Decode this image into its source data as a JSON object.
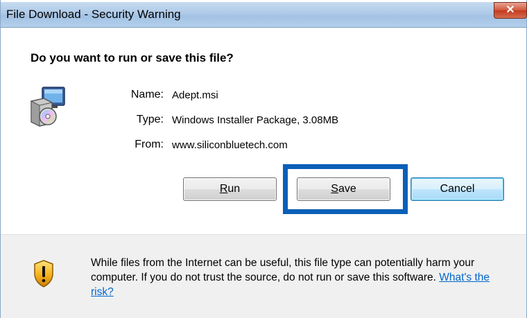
{
  "window": {
    "title": "File Download - Security Warning",
    "close_glyph": "✕"
  },
  "dialog": {
    "question": "Do you want to run or save this file?",
    "fields": {
      "name_label": "Name:",
      "name_value": "Adept.msi",
      "type_label": "Type:",
      "type_value": "Windows Installer Package, 3.08MB",
      "from_label": "From:",
      "from_value": "www.siliconbluetech.com"
    },
    "buttons": {
      "run_accel": "R",
      "run_rest": "un",
      "save_accel": "S",
      "save_rest": "ave",
      "cancel": "Cancel"
    }
  },
  "warning": {
    "text": "While files from the Internet can be useful, this file type can potentially harm your computer. If you do not trust the source, do not run or save this software.",
    "link": "What's the risk?"
  },
  "icons": {
    "installer": "installer-package-icon",
    "shield": "security-shield-icon",
    "close": "close-icon"
  },
  "colors": {
    "highlight": "#0a5fb8",
    "link": "#0066cc",
    "title_bar": "#b3cfec"
  }
}
